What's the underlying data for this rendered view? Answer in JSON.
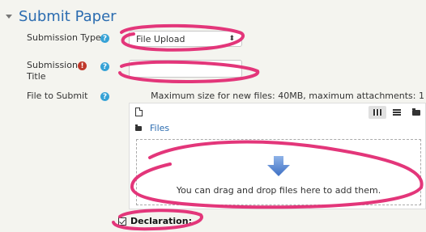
{
  "section": {
    "title": "Submit Paper",
    "expanded": true
  },
  "fields": {
    "submission_type": {
      "label": "Submission Type",
      "value": "File Upload"
    },
    "submission_title": {
      "label_line1": "Submission",
      "label_line2": "Title",
      "value": ""
    },
    "file_to_submit": {
      "label": "File to Submit",
      "max_size_text": "Maximum size for new files: 40MB, maximum attachments: 1"
    }
  },
  "filepicker": {
    "path_label": "Files",
    "drop_text": "You can drag and drop files here to add them."
  },
  "declaration": {
    "label": "Declaration:",
    "checked": true
  },
  "colors": {
    "accent": "#2b6cb0",
    "annotation": "#e3367a",
    "help": "#36a2d6",
    "required": "#c0392b"
  },
  "icons": [
    "caret-down-icon",
    "help-icon",
    "required-icon",
    "add-file-icon",
    "grid-view-icon",
    "list-view-icon",
    "tree-view-icon",
    "folder-icon",
    "download-arrow-icon"
  ]
}
